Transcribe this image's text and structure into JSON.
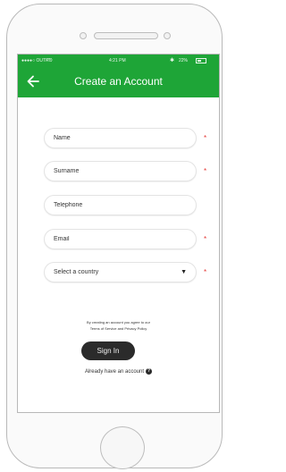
{
  "status_bar": {
    "carrier": "●●●●○ OUTRO",
    "wifi_icon": "wifi-icon",
    "time": "4:21 PM",
    "bluetooth_icon": "bluetooth-icon",
    "battery_pct": "22%"
  },
  "header": {
    "title": "Create an Account",
    "back_icon": "arrow-left-icon"
  },
  "form": {
    "name_placeholder": "Name",
    "surname_placeholder": "Surname",
    "telephone_placeholder": "Telephone",
    "email_placeholder": "Email",
    "country_select": "Select a country",
    "required_marker": "*"
  },
  "footer": {
    "terms_line1": "By creating an account you agree to our",
    "terms_line2": "Terms of Service and Privacy Policy",
    "signin_label": "Sign In",
    "already_text": "Already have an account",
    "help_glyph": "?"
  },
  "colors": {
    "brand_green": "#1ea537",
    "button_dark": "#2b2b2b",
    "required_red": "#e53935"
  }
}
